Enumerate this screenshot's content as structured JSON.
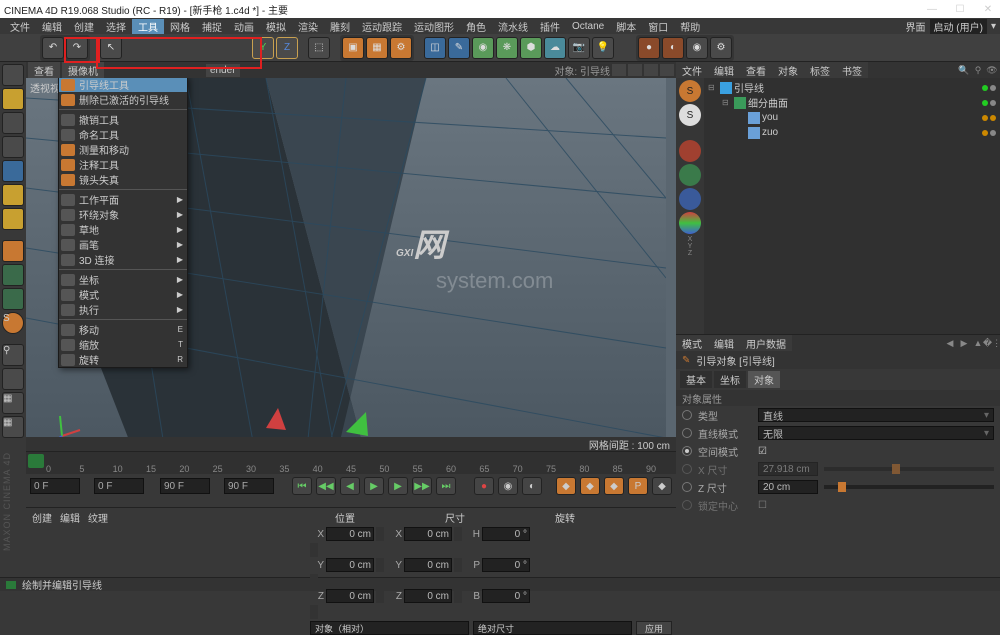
{
  "title": "CINEMA 4D R19.068 Studio (RC - R19) - [新手枪 1.c4d *] - 主要",
  "menubar": [
    "文件",
    "编辑",
    "创建",
    "选择",
    "工具",
    "网格",
    "捕捉",
    "动画",
    "模拟",
    "渲染",
    "雕刻",
    "运动跟踪",
    "运动图形",
    "角色",
    "流水线",
    "插件",
    "Octane",
    "脚本",
    "窗口",
    "帮助"
  ],
  "menubar_right": "界面   启动 (用户)",
  "layout_label": "界面",
  "layout_value": "启动 (用户)",
  "vp_tabs": {
    "left": [
      "查看",
      "摄像机"
    ],
    "right_label": "ender",
    "info": "对象: 引导线"
  },
  "dropdown": {
    "items": [
      {
        "label": "引导线工具",
        "sel": true,
        "ic": "o"
      },
      {
        "label": "删除已激活的引导线",
        "ic": "o"
      },
      {
        "sep": true
      },
      {
        "label": "撤销工具",
        "ic": ""
      },
      {
        "label": "命名工具",
        "ic": ""
      },
      {
        "label": "测量和移动",
        "ic": "o"
      },
      {
        "label": "注释工具",
        "ic": "o"
      },
      {
        "label": "镜头失真",
        "ic": "o"
      },
      {
        "sep": true
      },
      {
        "label": "工作平面",
        "arr": true
      },
      {
        "label": "环绕对象",
        "arr": true
      },
      {
        "label": "草地",
        "arr": true
      },
      {
        "label": "画笔",
        "arr": true
      },
      {
        "label": "3D 连接",
        "arr": true
      },
      {
        "sep": true
      },
      {
        "label": "坐标",
        "arr": true
      },
      {
        "label": "模式",
        "arr": true
      },
      {
        "label": "执行",
        "arr": true
      },
      {
        "sep": true
      },
      {
        "label": "移动",
        "key": "E"
      },
      {
        "label": "缩放",
        "key": "T"
      },
      {
        "label": "旋转",
        "key": "R"
      }
    ]
  },
  "vp_footer": "网格间距 : 100 cm",
  "timeline": {
    "ticks": [
      "0",
      "5",
      "10",
      "15",
      "20",
      "25",
      "30",
      "35",
      "40",
      "45",
      "50",
      "55",
      "60",
      "65",
      "70",
      "75",
      "80",
      "85",
      "90"
    ],
    "f1": "0 F",
    "f2": "  0 F",
    "f3": "90 F",
    "f4": "90 F"
  },
  "coords": {
    "tabs": [
      "创建",
      "编辑",
      "纹理"
    ],
    "heads": [
      "位置",
      "尺寸",
      "旋转"
    ],
    "rows": [
      {
        "a": "X",
        "av": "0 cm",
        "b": "X",
        "bv": "0 cm",
        "c": "H",
        "cv": "0 °"
      },
      {
        "a": "Y",
        "av": "0 cm",
        "b": "Y",
        "bv": "0 cm",
        "c": "P",
        "cv": "0 °"
      },
      {
        "a": "Z",
        "av": "0 cm",
        "b": "Z",
        "bv": "0 cm",
        "c": "B",
        "cv": "0 °"
      }
    ],
    "dd1": "对象（相对）",
    "dd2": "绝对尺寸",
    "btn": "应用"
  },
  "om": {
    "tabs": [
      "文件",
      "编辑",
      "查看",
      "对象",
      "标签",
      "书签"
    ],
    "tree": [
      {
        "depth": 0,
        "exp": "⊟",
        "ic": "#3aa0e0",
        "label": "引导线",
        "dots": [
          "#2c2",
          "#888"
        ]
      },
      {
        "depth": 1,
        "exp": "⊟",
        "ic": "#3a9a5a",
        "label": "细分曲面",
        "dots": [
          "#2c2",
          "#888"
        ]
      },
      {
        "depth": 2,
        "exp": "",
        "ic": "#6aa0d8",
        "label": "you",
        "dots": [
          "#c80",
          "#c80"
        ]
      },
      {
        "depth": 2,
        "exp": "",
        "ic": "#6aa0d8",
        "label": "zuo",
        "dots": [
          "#c80",
          "#888"
        ]
      }
    ]
  },
  "attr": {
    "tabs": [
      "模式",
      "编辑",
      "用户数据"
    ],
    "title": "引导对象 [引导线]",
    "subtabs": [
      "基本",
      "坐标",
      "对象"
    ],
    "section": "对象属性",
    "rows": [
      {
        "type": "dd",
        "lbl": "类型",
        "val": "直线"
      },
      {
        "type": "dd",
        "lbl": "直线模式",
        "val": "无限"
      },
      {
        "type": "chk",
        "lbl": "空间模式",
        "val": "☑"
      },
      {
        "type": "slider",
        "lbl": "X 尺寸",
        "val": "27.918 cm",
        "dim": true
      },
      {
        "type": "slider",
        "lbl": "Z 尺寸",
        "val": "20 cm"
      },
      {
        "type": "chk",
        "lbl": "锁定中心",
        "val": "☐",
        "dim": true
      }
    ]
  },
  "statusbar": "绘制并编辑引导线",
  "sidelabel": "MAXON CINEMA 4D",
  "watermark1": "GXI",
  "watermark2": "网",
  "watermark3": "system.com",
  "viewport_label": "透视视图"
}
